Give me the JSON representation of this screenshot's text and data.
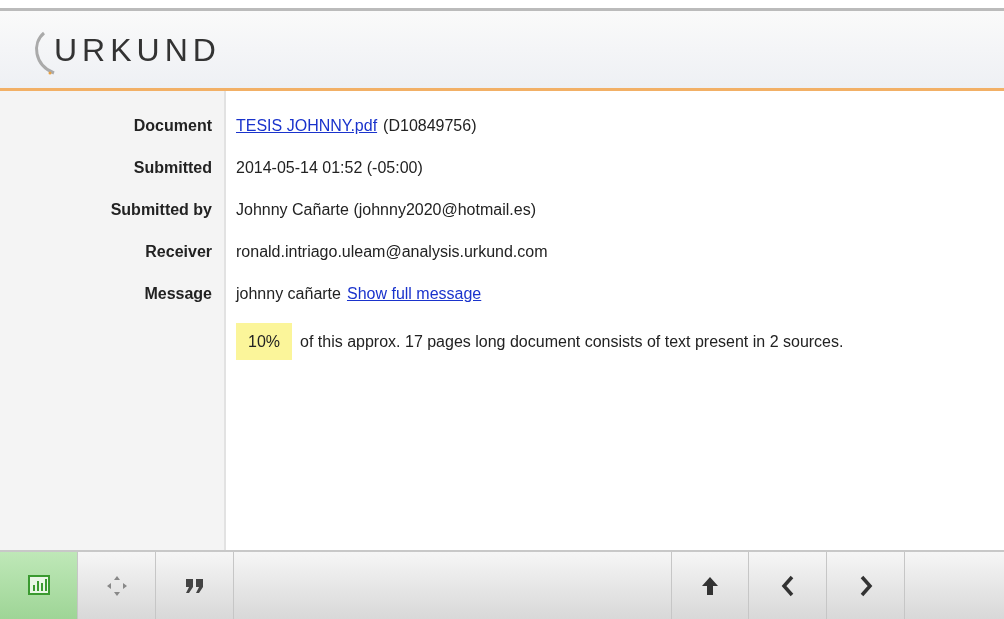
{
  "logo": {
    "text": "URKUND"
  },
  "fields": [
    {
      "label": "Document",
      "parts": [
        {
          "kind": "link",
          "text": "TESIS JOHNNY.pdf"
        },
        {
          "kind": "text",
          "text": "(D10849756)"
        }
      ]
    },
    {
      "label": "Submitted",
      "parts": [
        {
          "kind": "text",
          "text": "2014-05-14 01:52 (-05:00)"
        }
      ]
    },
    {
      "label": "Submitted by",
      "parts": [
        {
          "kind": "text",
          "text": "Johnny Cañarte (johnny2020@hotmail.es)"
        }
      ]
    },
    {
      "label": "Receiver",
      "parts": [
        {
          "kind": "text",
          "text": "ronald.intriago.uleam@analysis.urkund.com"
        }
      ]
    },
    {
      "label": "Message",
      "parts": [
        {
          "kind": "text",
          "text": "johnny cañarte"
        },
        {
          "kind": "link",
          "text": "Show full message"
        }
      ]
    }
  ],
  "summary": {
    "percentage": "10%",
    "text": "of this approx. 17 pages long document consists of text present in 2 sources."
  },
  "toolbar": {
    "left": [
      {
        "kind": "chart",
        "selected": true
      },
      {
        "kind": "target",
        "selected": false
      },
      {
        "kind": "quote",
        "selected": false
      }
    ],
    "right": [
      {
        "kind": "up"
      },
      {
        "kind": "prev"
      },
      {
        "kind": "next"
      }
    ]
  }
}
